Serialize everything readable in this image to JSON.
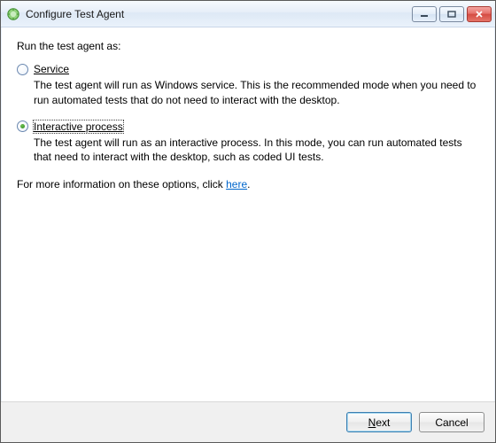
{
  "window": {
    "title": "Configure Test Agent"
  },
  "content": {
    "heading": "Run the test agent as:",
    "options": {
      "service": {
        "label": "Service",
        "description": "The test agent will run as Windows service. This is the recommended mode when you need to run automated tests that do not need to interact with the desktop.",
        "checked": false
      },
      "interactive": {
        "label": "Interactive process",
        "description": "The test agent will run as an interactive process. In this mode, you can run automated tests that need to interact with the desktop, such as coded UI tests.",
        "checked": true
      }
    },
    "more_info_prefix": "For more information on these options, click ",
    "more_info_link": "here",
    "more_info_suffix": "."
  },
  "footer": {
    "next": "Next",
    "cancel": "Cancel"
  }
}
